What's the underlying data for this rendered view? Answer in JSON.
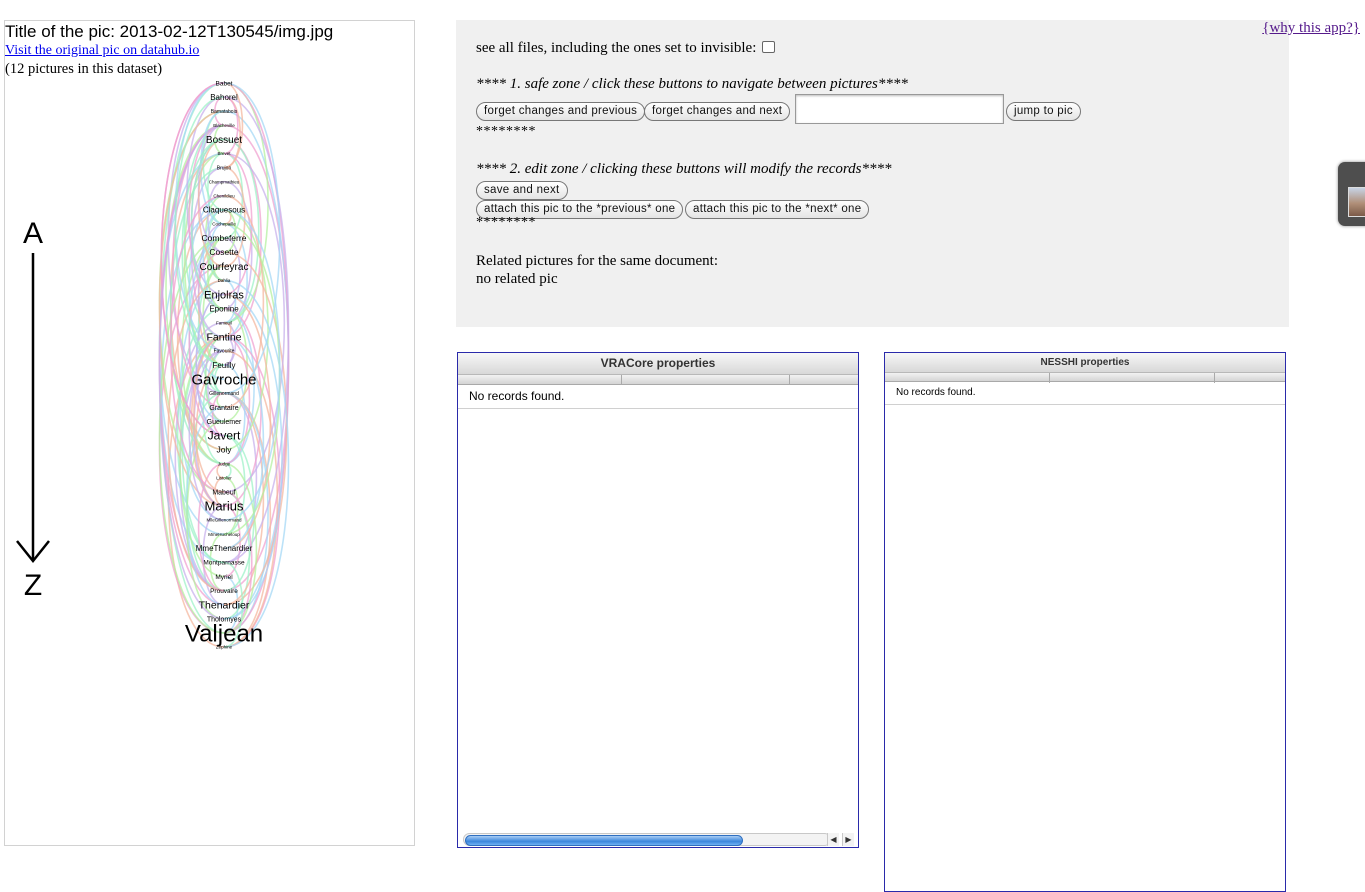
{
  "left": {
    "title": "Title of the pic: 2013-02-12T130545/img.jpg",
    "link_text": "Visit the original pic on datahub.io",
    "count_text": "(12 pictures in this dataset)",
    "arrow_start": "A",
    "arrow_end": "Z",
    "diagram_labels": [
      {
        "text": "Babet",
        "size": 6.5
      },
      {
        "text": "Bahorel",
        "size": 8
      },
      {
        "text": "Bamatabois",
        "size": 5
      },
      {
        "text": "Blacheville",
        "size": 4.5
      },
      {
        "text": "Bossuet",
        "size": 10
      },
      {
        "text": "Brevet",
        "size": 4.5
      },
      {
        "text": "Brujon",
        "size": 5
      },
      {
        "text": "Champmathieu",
        "size": 4.5
      },
      {
        "text": "Chenildieu",
        "size": 4.5
      },
      {
        "text": "Claquesous",
        "size": 8
      },
      {
        "text": "Cochepaille",
        "size": 4.5
      },
      {
        "text": "Combeferre",
        "size": 8.5
      },
      {
        "text": "Cosette",
        "size": 8.5
      },
      {
        "text": "Courfeyrac",
        "size": 10
      },
      {
        "text": "Dahlia",
        "size": 4.5
      },
      {
        "text": "Enjolras",
        "size": 11
      },
      {
        "text": "Eponine",
        "size": 8
      },
      {
        "text": "Fameuil",
        "size": 4.5
      },
      {
        "text": "Fantine",
        "size": 10.5
      },
      {
        "text": "Favourite",
        "size": 5
      },
      {
        "text": "Feuilly",
        "size": 8
      },
      {
        "text": "Gavroche",
        "size": 15
      },
      {
        "text": "Gillenormand",
        "size": 5
      },
      {
        "text": "Grantaire",
        "size": 7
      },
      {
        "text": "Gueulemer",
        "size": 7
      },
      {
        "text": "Javert",
        "size": 12
      },
      {
        "text": "Joly",
        "size": 8.5
      },
      {
        "text": "Judge",
        "size": 4.5
      },
      {
        "text": "Listolier",
        "size": 4.5
      },
      {
        "text": "Mabeuf",
        "size": 7
      },
      {
        "text": "Marius",
        "size": 13
      },
      {
        "text": "MlleGillenormand",
        "size": 4.5
      },
      {
        "text": "MmeHucheloup",
        "size": 4.5
      },
      {
        "text": "MmeThenardier",
        "size": 8
      },
      {
        "text": "Montparnasse",
        "size": 6.5
      },
      {
        "text": "Myriel",
        "size": 6.5
      },
      {
        "text": "Prouvaire",
        "size": 6.5
      },
      {
        "text": "Thenardier",
        "size": 10.5
      },
      {
        "text": "Tholomyes",
        "size": 7
      },
      {
        "text": "Valjean",
        "size": 24
      },
      {
        "text": "Zephine",
        "size": 4.5
      }
    ]
  },
  "control": {
    "show_all_text": "see all files, including the ones set to invisible:",
    "safe_zone_text": "**** 1. safe zone / click these buttons to navigate between pictures****",
    "forget_prev_label": "forget changes and previous",
    "forget_next_label": "forget changes and next",
    "jump_input_value": "",
    "jump_label": "jump to pic",
    "stars_1": "********",
    "edit_zone_text": "**** 2. edit zone / clicking these buttons will modify the records****",
    "save_next_label": "save and next",
    "attach_prev_label": "attach this pic to the *previous* one",
    "attach_next_label": "attach this pic to the *next* one",
    "stars_2": "********",
    "related_title": "Related pictures for the same document:",
    "related_value": "no related pic"
  },
  "why_link": "{why this app?}",
  "grid_vra": {
    "caption": "VRACore properties",
    "empty_text": "No records found."
  },
  "grid_nesshi": {
    "caption": "NESSHI properties",
    "empty_text": "No records found."
  },
  "colors": {
    "panel_bg": "#f0f0f0",
    "grid_border": "#2a2aaa",
    "link": "#0000ee",
    "visited_link": "#551a8b",
    "arc_colors": [
      "#9ff2c8",
      "#a6d8f5",
      "#f0a2d0",
      "#c8b2ec",
      "#b4f0a0",
      "#f4b8a0"
    ]
  }
}
